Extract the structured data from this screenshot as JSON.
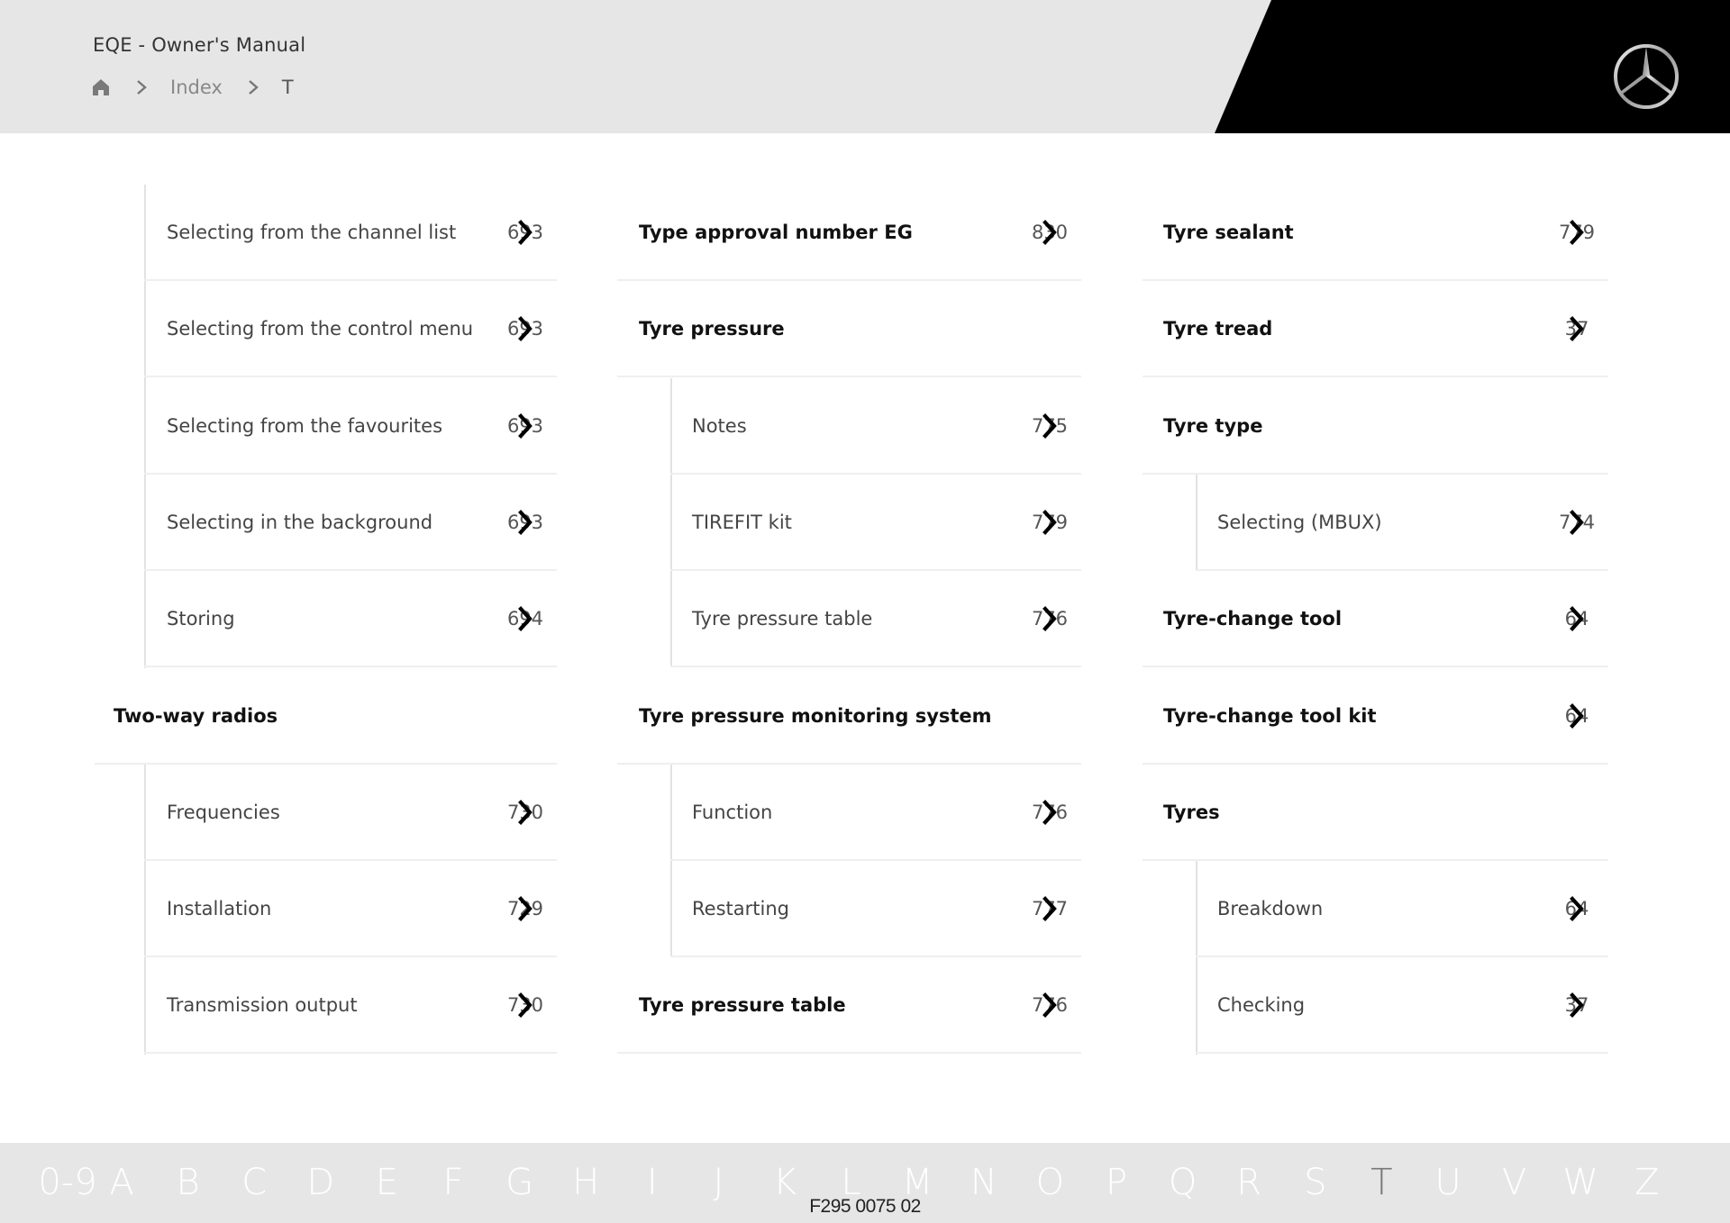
{
  "header": {
    "title": "EQE - Owner's Manual",
    "breadcrumb": {
      "home_icon": "home-icon",
      "separator_icon": "chevron-right-icon",
      "items": [
        "Index",
        "T"
      ]
    },
    "logo": "mercedes-star-logo"
  },
  "columns": [
    {
      "rows": [
        {
          "type": "sub",
          "label": "Selecting from the channel list",
          "page": "693"
        },
        {
          "type": "sub",
          "label": "Selecting from the control menu",
          "page": "693"
        },
        {
          "type": "sub",
          "label": "Selecting from the favourites",
          "page": "693"
        },
        {
          "type": "sub",
          "label": "Selecting in the background",
          "page": "693"
        },
        {
          "type": "sub",
          "label": "Storing",
          "page": "694"
        },
        {
          "type": "head",
          "label": "Two-way radios",
          "page": ""
        },
        {
          "type": "sub",
          "label": "Frequencies",
          "page": "730"
        },
        {
          "type": "sub",
          "label": "Installation",
          "page": "729"
        },
        {
          "type": "sub",
          "label": "Transmission output",
          "page": "730"
        }
      ]
    },
    {
      "rows": [
        {
          "type": "head",
          "label": "Type approval number EG",
          "page": "830"
        },
        {
          "type": "head",
          "label": "Tyre pressure",
          "page": ""
        },
        {
          "type": "sub",
          "label": "Notes",
          "page": "775"
        },
        {
          "type": "sub",
          "label": "TIREFIT kit",
          "page": "779"
        },
        {
          "type": "sub",
          "label": "Tyre pressure table",
          "page": "776"
        },
        {
          "type": "head",
          "label": "Tyre pressure monitoring system",
          "page": ""
        },
        {
          "type": "sub",
          "label": "Function",
          "page": "776"
        },
        {
          "type": "sub",
          "label": "Restarting",
          "page": "777"
        },
        {
          "type": "head",
          "label": "Tyre pressure table",
          "page": "776"
        }
      ]
    },
    {
      "rows": [
        {
          "type": "head",
          "label": "Tyre sealant",
          "page": "779"
        },
        {
          "type": "head",
          "label": "Tyre tread",
          "page": "37"
        },
        {
          "type": "head",
          "label": "Tyre type",
          "page": ""
        },
        {
          "type": "sub",
          "label": "Selecting (MBUX)",
          "page": "774"
        },
        {
          "type": "head",
          "label": "Tyre-change tool",
          "page": "64"
        },
        {
          "type": "head",
          "label": "Tyre-change tool kit",
          "page": "64"
        },
        {
          "type": "head",
          "label": "Tyres",
          "page": ""
        },
        {
          "type": "sub",
          "label": "Breakdown",
          "page": "64"
        },
        {
          "type": "sub",
          "label": "Checking",
          "page": "37"
        }
      ]
    }
  ],
  "row_link_icon": "chevron-right-icon",
  "alphabet": {
    "letters": [
      "0-9",
      "A",
      "B",
      "C",
      "D",
      "E",
      "F",
      "G",
      "H",
      "I",
      "J",
      "K",
      "L",
      "M",
      "N",
      "O",
      "P",
      "Q",
      "R",
      "S",
      "T",
      "U",
      "V",
      "W",
      "Z"
    ],
    "active": "T"
  },
  "footer": {
    "doc_code": "F295 0075 02"
  },
  "colors": {
    "header_bg": "#e6e6e6",
    "brand_black": "#000000",
    "footer_bg": "#e6e6e6",
    "alphabet_inactive": "#ffffff",
    "alphabet_active": "#777777"
  }
}
